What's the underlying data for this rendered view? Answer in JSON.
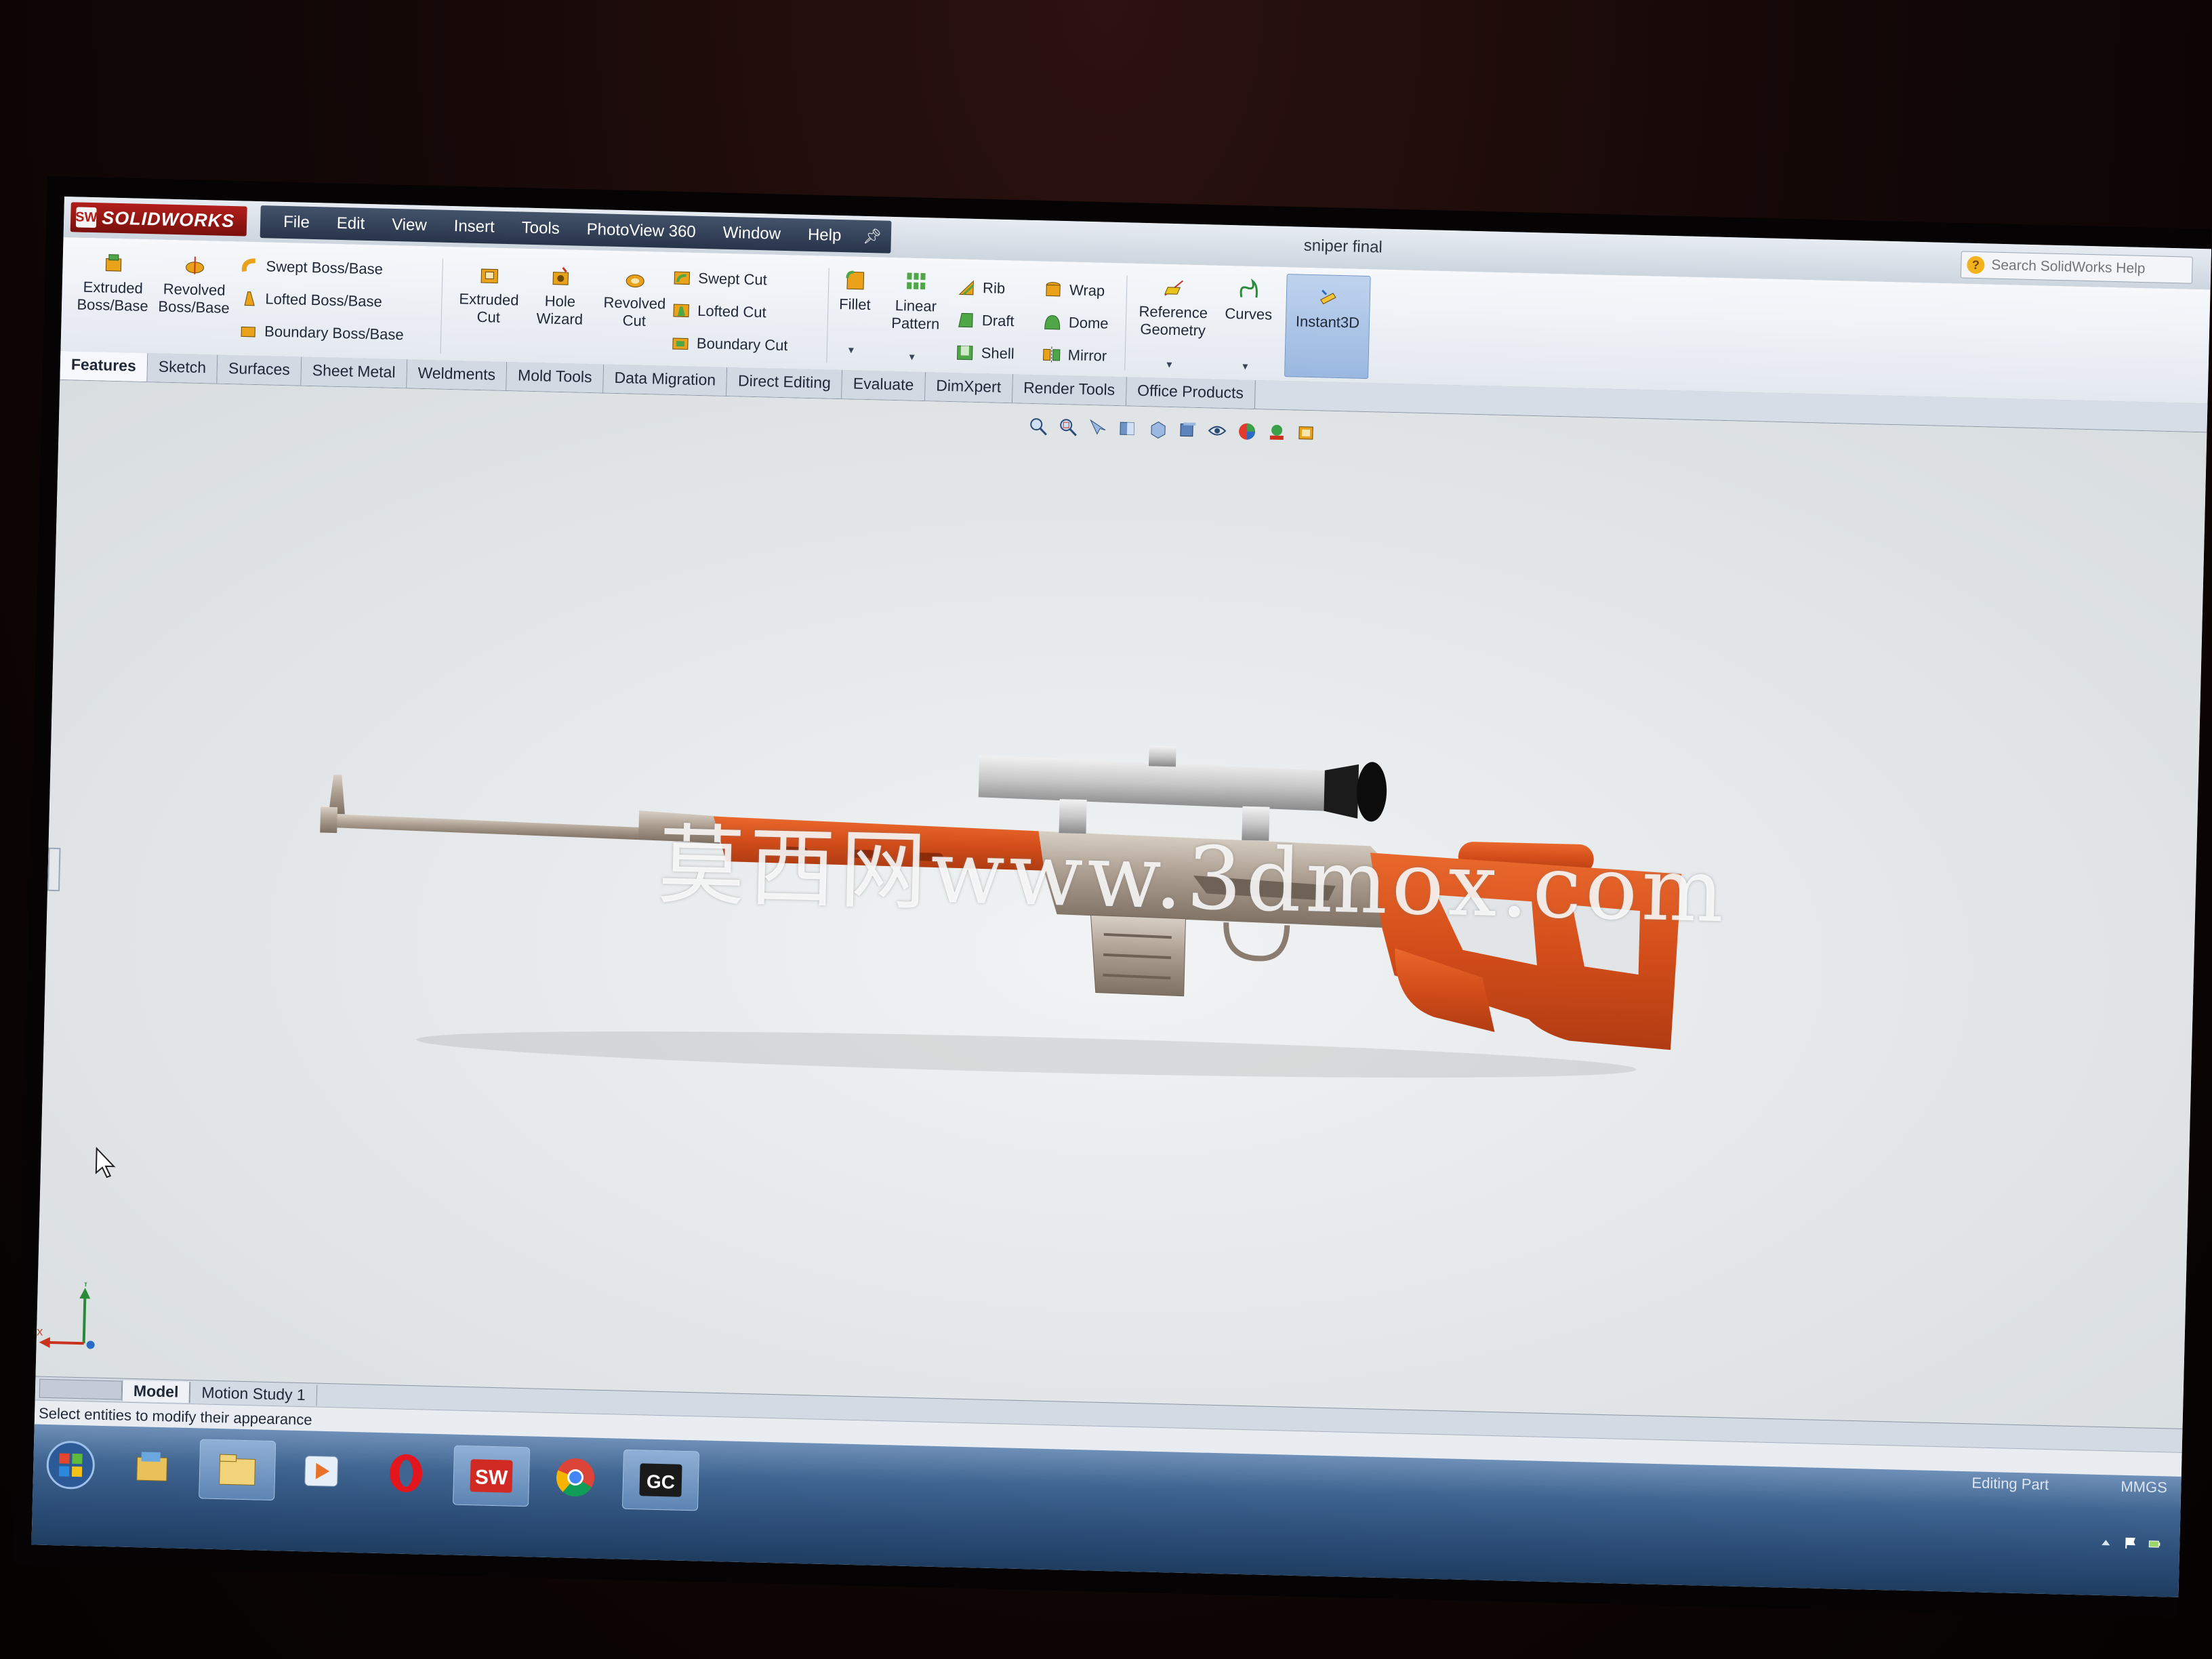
{
  "app": {
    "logo_text": "SOLIDWORKS",
    "logo_mark": "SW",
    "document_title": "sniper final"
  },
  "menu": {
    "items": [
      "File",
      "Edit",
      "View",
      "Insert",
      "Tools",
      "PhotoView 360",
      "Window",
      "Help"
    ],
    "pin_icon": "pushpin-icon"
  },
  "search": {
    "placeholder": "Search SolidWorks Help"
  },
  "ribbon": {
    "extruded_boss": "Extruded\nBoss/Base",
    "revolved_boss": "Revolved\nBoss/Base",
    "swept_boss": "Swept Boss/Base",
    "lofted_boss": "Lofted Boss/Base",
    "boundary_boss": "Boundary Boss/Base",
    "extruded_cut": "Extruded\nCut",
    "hole_wizard": "Hole\nWizard",
    "revolved_cut": "Revolved\nCut",
    "swept_cut": "Swept Cut",
    "lofted_cut": "Lofted Cut",
    "boundary_cut": "Boundary Cut",
    "fillet": "Fillet",
    "linear_pattern": "Linear\nPattern",
    "rib": "Rib",
    "draft": "Draft",
    "shell": "Shell",
    "wrap": "Wrap",
    "dome": "Dome",
    "mirror": "Mirror",
    "reference_geometry": "Reference\nGeometry",
    "curves": "Curves",
    "instant3d": "Instant3D"
  },
  "tabs": [
    "Features",
    "Sketch",
    "Surfaces",
    "Sheet Metal",
    "Weldments",
    "Mold Tools",
    "Data Migration",
    "Direct Editing",
    "Evaluate",
    "DimXpert",
    "Render Tools",
    "Office Products"
  ],
  "active_tab": "Features",
  "viewport": {
    "watermark": "莫西网www.3dmox.com",
    "triad_x": "X",
    "triad_y": "Y"
  },
  "bottom_tabs": [
    "Model",
    "Motion Study 1"
  ],
  "status": {
    "message": "Select entities to modify their appearance",
    "mode": "Editing Part",
    "units": "MMGS"
  },
  "taskbar": {
    "apps": [
      "start-orb-icon",
      "explorer-icon",
      "libraries-folder-icon",
      "media-player-icon",
      "opera-icon",
      "solidworks-taskbar-icon",
      "chrome-icon",
      "gc-icon"
    ],
    "sw_label": "SW",
    "gc_label": "GC"
  },
  "colors": {
    "accent_red": "#b21e1a",
    "stock_orange": "#d9531e",
    "menu_dark": "#2c3a52",
    "taskbar_blue": "#3f6590"
  }
}
